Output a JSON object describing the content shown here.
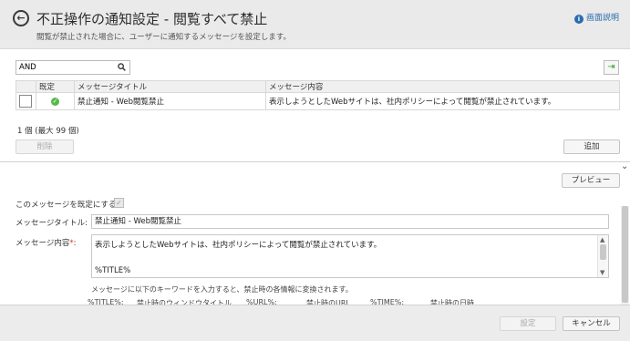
{
  "header": {
    "title": "不正操作の通知設定 - 閲覧すべて禁止",
    "subtitle": "閲覧が禁止された場合に、ユーザーに通知するメッセージを設定します。",
    "help_label": "画面説明"
  },
  "search": {
    "value": "AND"
  },
  "table": {
    "headers": [
      "既定",
      "メッセージタイトル",
      "メッセージ内容"
    ],
    "rows": [
      {
        "title": "禁止通知 - Web閲覧禁止",
        "content": "表示しようとしたWebサイトは、社内ポリシーによって閲覧が禁止されています。"
      }
    ]
  },
  "count_text": "1 個 (最大 99 個)",
  "buttons": {
    "delete": "削除",
    "add": "追加",
    "preview": "プレビュー",
    "ok": "設定",
    "cancel": "キャンセル"
  },
  "form": {
    "default_label": "このメッセージを既定にする:",
    "title_label": "メッセージタイトル:",
    "title_value": "禁止通知 - Web閲覧禁止",
    "content_label": "メッセージ内容",
    "required_mark": "*",
    "content_colon": ":",
    "content_line1": "表示しようとしたWebサイトは、社内ポリシーによって閲覧が禁止されています。",
    "content_line2": "%TITLE%",
    "keyword_hint": "メッセージに以下のキーワードを入力すると、禁止時の各情報に変換されます。",
    "keywords": [
      {
        "key": "%TITLE%:",
        "desc": "禁止時のウィンドウタイトル"
      },
      {
        "key": "%URL%:",
        "desc": "禁止時のURL"
      },
      {
        "key": "%TIME%:",
        "desc": "禁止時の日時"
      }
    ]
  },
  "colors": {
    "header_bg": "#eaeaea",
    "link_blue": "#2a6cb0",
    "status_green": "#56b94a",
    "required_red": "#d9342b"
  },
  "icons": {
    "back": "back-arrow-circle-icon",
    "help": "info-icon",
    "search": "search-icon",
    "export": "export-icon",
    "default_status": "check-circle-icon",
    "collapse": "chevron-down-icon"
  }
}
